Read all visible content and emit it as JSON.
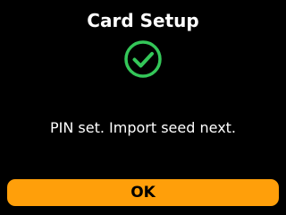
{
  "screen": {
    "title": "Card Setup",
    "status_icon": "check-circle-icon",
    "message": "PIN set. Import seed next."
  },
  "actions": {
    "ok_label": "OK"
  },
  "colors": {
    "background": "#000000",
    "text": "#ffffff",
    "success": "#34c759",
    "button": "#ff9f0a",
    "button_text": "#000000"
  }
}
